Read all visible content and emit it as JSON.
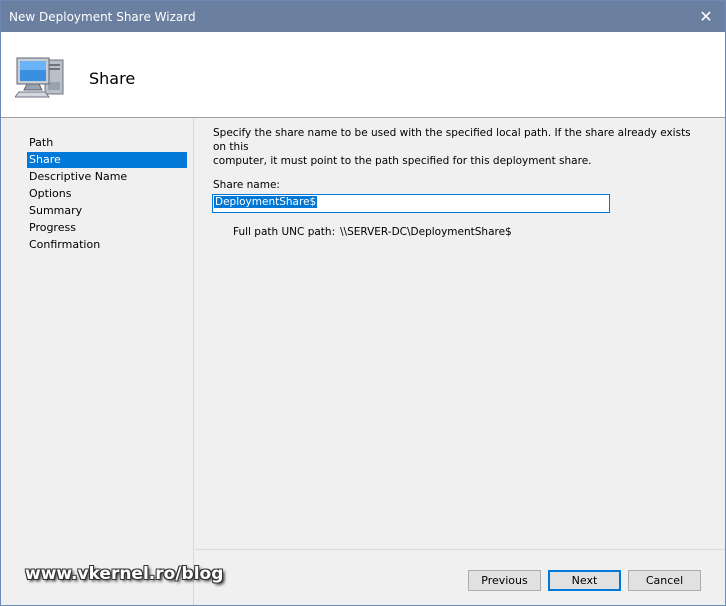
{
  "window": {
    "title": "New Deployment Share Wizard",
    "close_glyph": "✕"
  },
  "header": {
    "icon": "computer-icon",
    "heading": "Share"
  },
  "sidebar": {
    "items": [
      {
        "label": "Path",
        "active": false
      },
      {
        "label": "Share",
        "active": true
      },
      {
        "label": "Descriptive Name",
        "active": false
      },
      {
        "label": "Options",
        "active": false
      },
      {
        "label": "Summary",
        "active": false
      },
      {
        "label": "Progress",
        "active": false
      },
      {
        "label": "Confirmation",
        "active": false
      }
    ]
  },
  "main": {
    "intro_line1": "Specify the share name to be used with the specified local path.  If the share already exists on this",
    "intro_line2": "computer, it must point to the path specified for this deployment share.",
    "share_name_label": "Share name:",
    "share_name_value": "DeploymentShare$",
    "unc_label": "Full path UNC path:",
    "unc_value": "\\\\SERVER-DC\\DeploymentShare$"
  },
  "buttons": {
    "previous": "Previous",
    "next": "Next",
    "cancel": "Cancel"
  },
  "watermark": "www.vkernel.ro/blog",
  "colors": {
    "titlebar": "#6b7fa0",
    "selection": "#0078d7",
    "background": "#f0f0f0"
  }
}
